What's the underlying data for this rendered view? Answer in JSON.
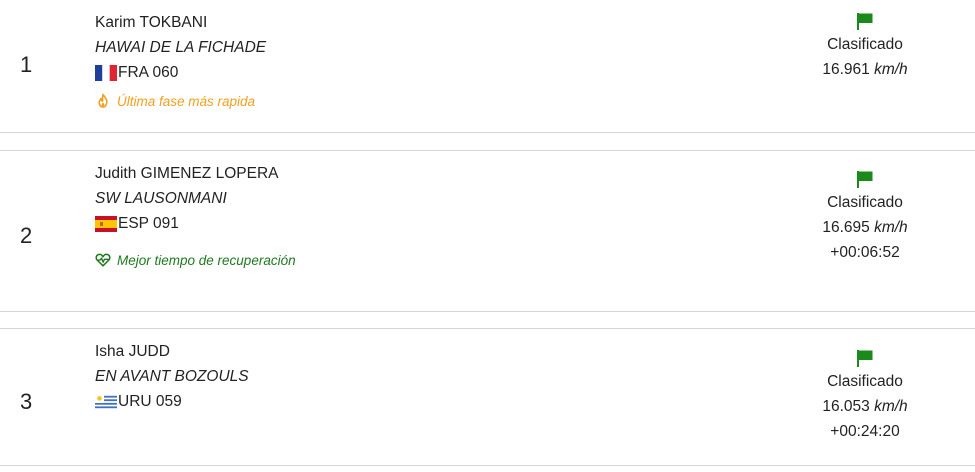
{
  "results": [
    {
      "rank": "1",
      "rider": "Karim TOKBANI",
      "horse": "HAWAI DE LA FICHADE",
      "nation": "FRA 060",
      "flag": "flag-fra",
      "badge": "Última fase más rapida",
      "badge_icon": "fire-icon",
      "badge_color": "#f0a01e",
      "status": "Clasificado",
      "speed": "16.961",
      "speed_unit": "km/h",
      "gap": ""
    },
    {
      "rank": "2",
      "rider": "Judith GIMENEZ LOPERA",
      "horse": "SW LAUSONMANI",
      "nation": "ESP 091",
      "flag": "flag-esp",
      "badge": "Mejor tiempo de recuperación",
      "badge_icon": "heartbeat-icon",
      "badge_color": "#1f7a1f",
      "status": "Clasificado",
      "speed": "16.695",
      "speed_unit": "km/h",
      "gap": "+00:06:52"
    },
    {
      "rank": "3",
      "rider": "Isha JUDD",
      "horse": "EN AVANT BOZOULS",
      "nation": "URU 059",
      "flag": "flag-uru",
      "badge": "",
      "badge_icon": "",
      "badge_color": "",
      "status": "Clasificado",
      "speed": "16.053",
      "speed_unit": "km/h",
      "gap": "+00:24:20"
    }
  ],
  "colors": {
    "status_flag": "#1a8a1a",
    "divider": "#d6d6d6"
  }
}
